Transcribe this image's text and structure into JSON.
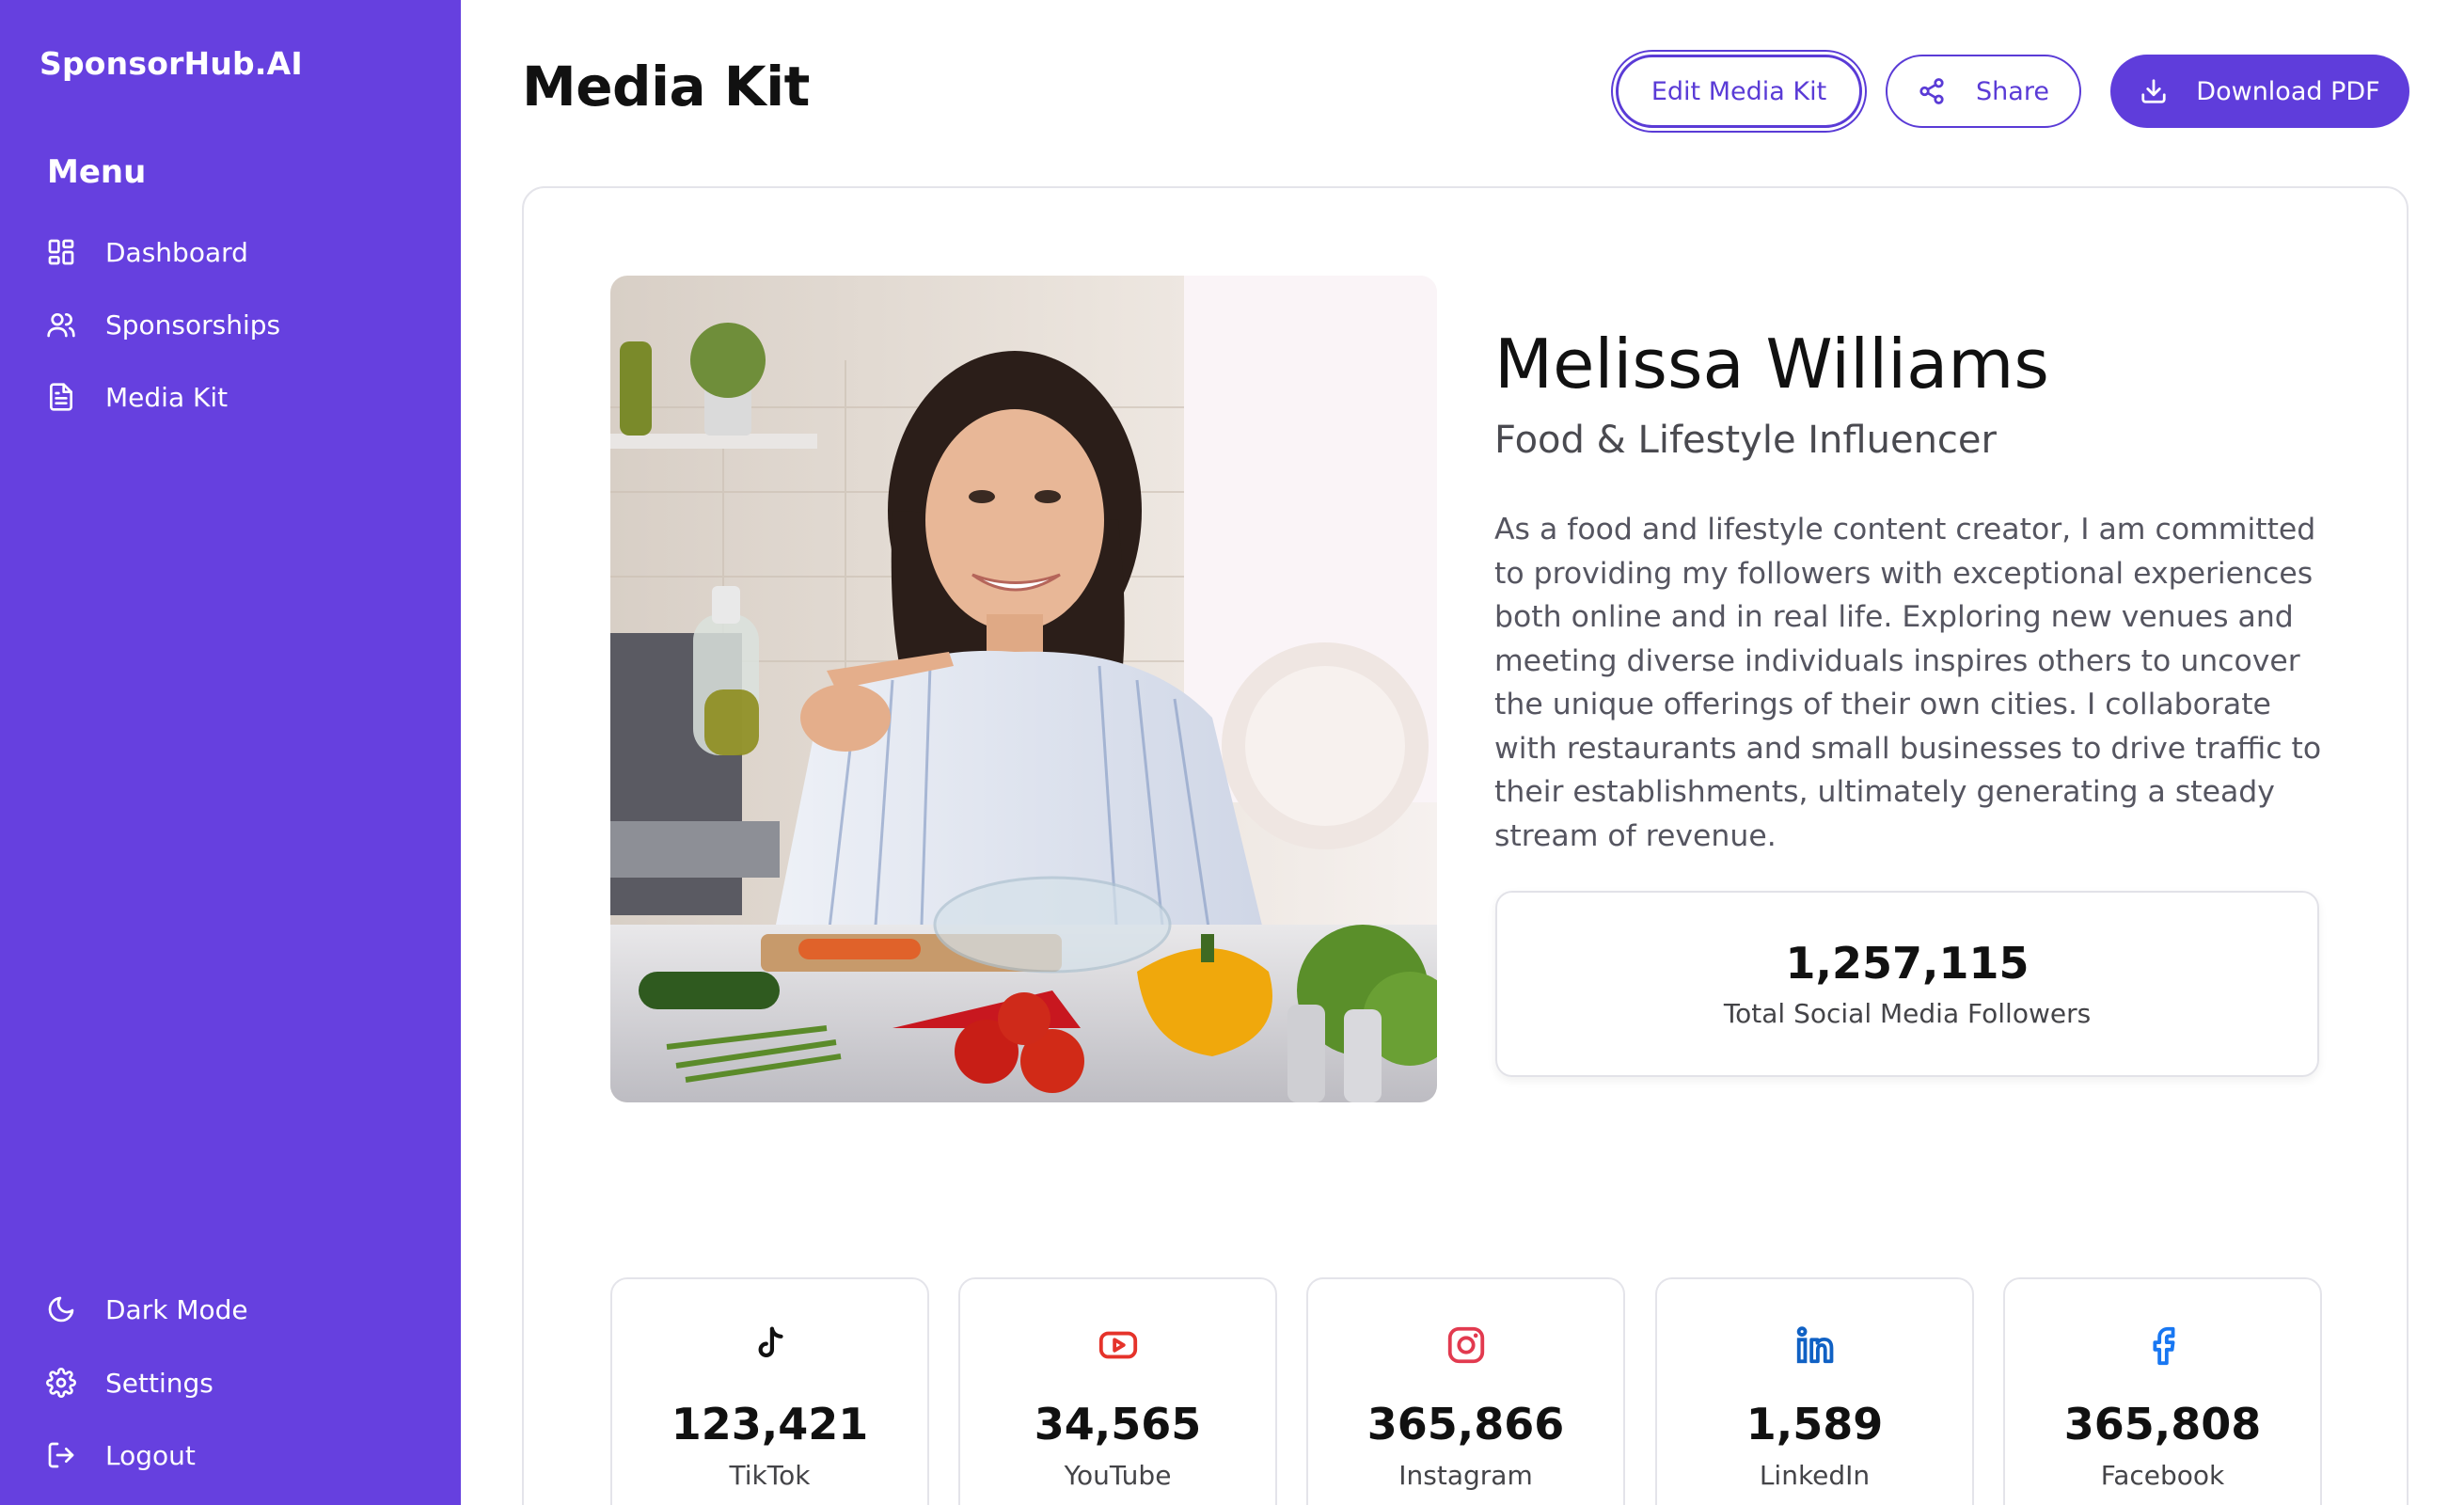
{
  "app": {
    "brand": "SponsorHub.AI"
  },
  "sidebar": {
    "menu_heading": "Menu",
    "items": [
      {
        "label": "Dashboard",
        "icon": "dashboard-icon"
      },
      {
        "label": "Sponsorships",
        "icon": "users-icon"
      },
      {
        "label": "Media Kit",
        "icon": "document-icon"
      }
    ],
    "bottom_items": [
      {
        "label": "Dark Mode",
        "icon": "moon-icon"
      },
      {
        "label": "Settings",
        "icon": "gear-icon"
      },
      {
        "label": "Logout",
        "icon": "logout-icon"
      }
    ]
  },
  "header": {
    "title": "Media Kit",
    "edit_label": "Edit Media Kit",
    "share_label": "Share",
    "download_label": "Download PDF"
  },
  "profile": {
    "name": "Melissa Williams",
    "tagline": "Food & Lifestyle Influencer",
    "bio": "As a food and lifestyle content creator, I am committed to providing my followers with exceptional experiences both online and in real life. Exploring new venues and meeting diverse individuals inspires others to uncover the unique offerings of their own cities. I collaborate with restaurants and small businesses to drive traffic to their establishments, ultimately generating a steady stream of revenue.",
    "total_followers": "1,257,115",
    "total_label": "Total Social Media Followers"
  },
  "socials": [
    {
      "platform": "TikTok",
      "followers": "123,421",
      "icon": "tiktok-icon",
      "color": "#111111"
    },
    {
      "platform": "YouTube",
      "followers": "34,565",
      "icon": "youtube-icon",
      "color": "#e5332a"
    },
    {
      "platform": "Instagram",
      "followers": "365,866",
      "icon": "instagram-icon",
      "color": "#e23a4f"
    },
    {
      "platform": "LinkedIn",
      "followers": "1,589",
      "icon": "linkedin-icon",
      "color": "#1061c4"
    },
    {
      "platform": "Facebook",
      "followers": "365,808",
      "icon": "facebook-icon",
      "color": "#1877f2"
    }
  ],
  "colors": {
    "sidebar": "#6640df",
    "accent": "#5a3bd6"
  }
}
